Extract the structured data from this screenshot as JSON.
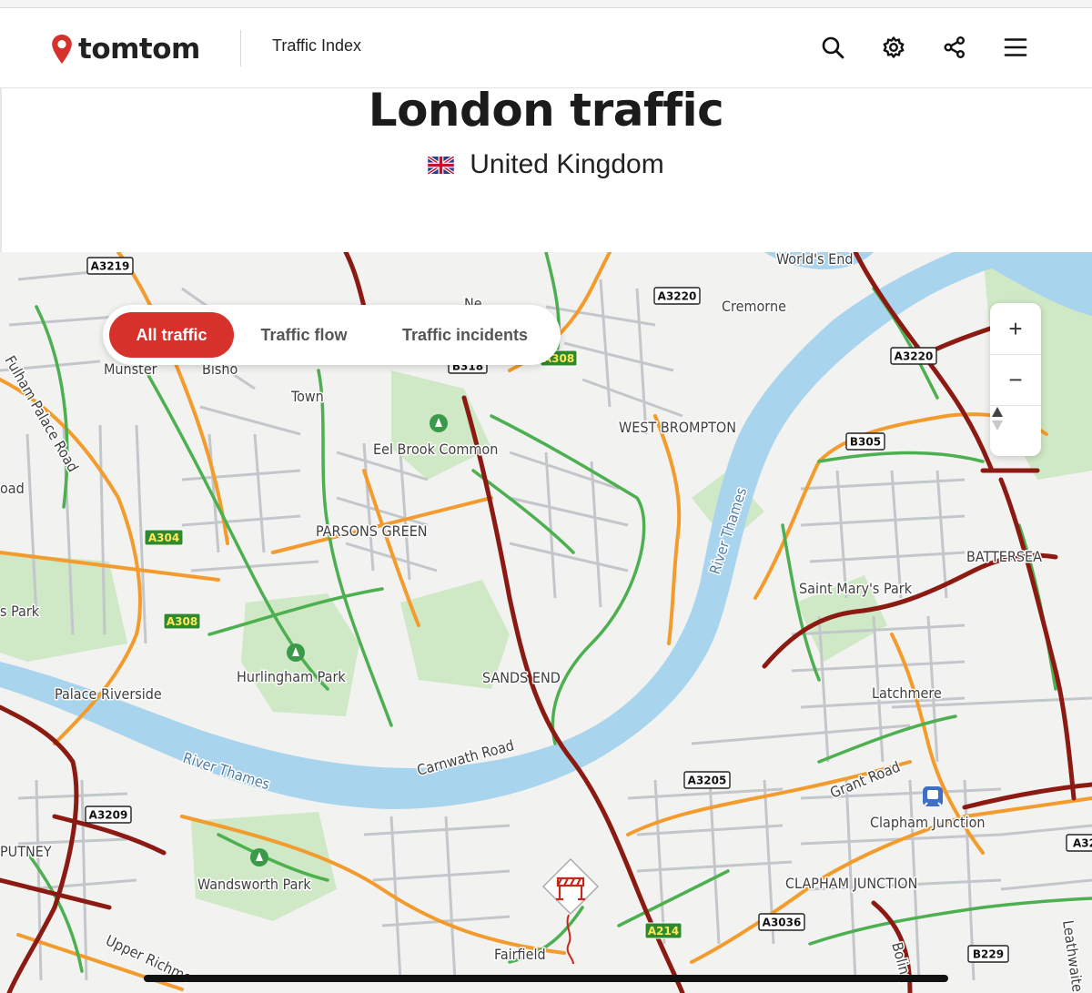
{
  "header": {
    "logo_text": "tomtom",
    "section": "Traffic Index",
    "icons": [
      "search-icon",
      "gear-icon",
      "share-icon",
      "menu-icon"
    ]
  },
  "hero": {
    "title": "London traffic",
    "country": "United Kingdom"
  },
  "map": {
    "tabs": [
      {
        "label": "All traffic",
        "active": true
      },
      {
        "label": "Traffic flow",
        "active": false
      },
      {
        "label": "Traffic incidents",
        "active": false
      }
    ],
    "zoom": {
      "in": "+",
      "out": "−"
    },
    "area_labels": [
      "World's End",
      "Cremorne",
      "Munster",
      "Town",
      "Eel Brook Common",
      "WEST BROMPTON",
      "Fulham Palace Road",
      "PARSONS GREEN",
      "River Thames",
      "BATTERSEA",
      "Saint Mary's Park",
      "s Park",
      "Hurlingham Park",
      "SANDS END",
      "Palace Riverside",
      "Latchmere",
      "Carnwath Road",
      "Grant Road",
      "Clapham Junction",
      "PUTNEY",
      "Wandsworth Park",
      "CLAPHAM JUNCTION",
      "Upper Richmo",
      "Fairfield",
      "Boling",
      "Leathwaite",
      "Bisho",
      "Ne",
      "oad"
    ],
    "road_shields": [
      "A3219",
      "A3220",
      "A3220",
      "B305",
      "B318",
      "A308",
      "A304",
      "A308",
      "A3205",
      "A3209",
      "A3036",
      "A214",
      "B229",
      "A32"
    ],
    "colors": {
      "brand_red": "#d6312a",
      "jam_dark": "#8b1a12",
      "slow_orange": "#f39b2c",
      "free_green": "#4caf50",
      "river": "#a9d4ee",
      "park": "#cfe8c5"
    }
  }
}
